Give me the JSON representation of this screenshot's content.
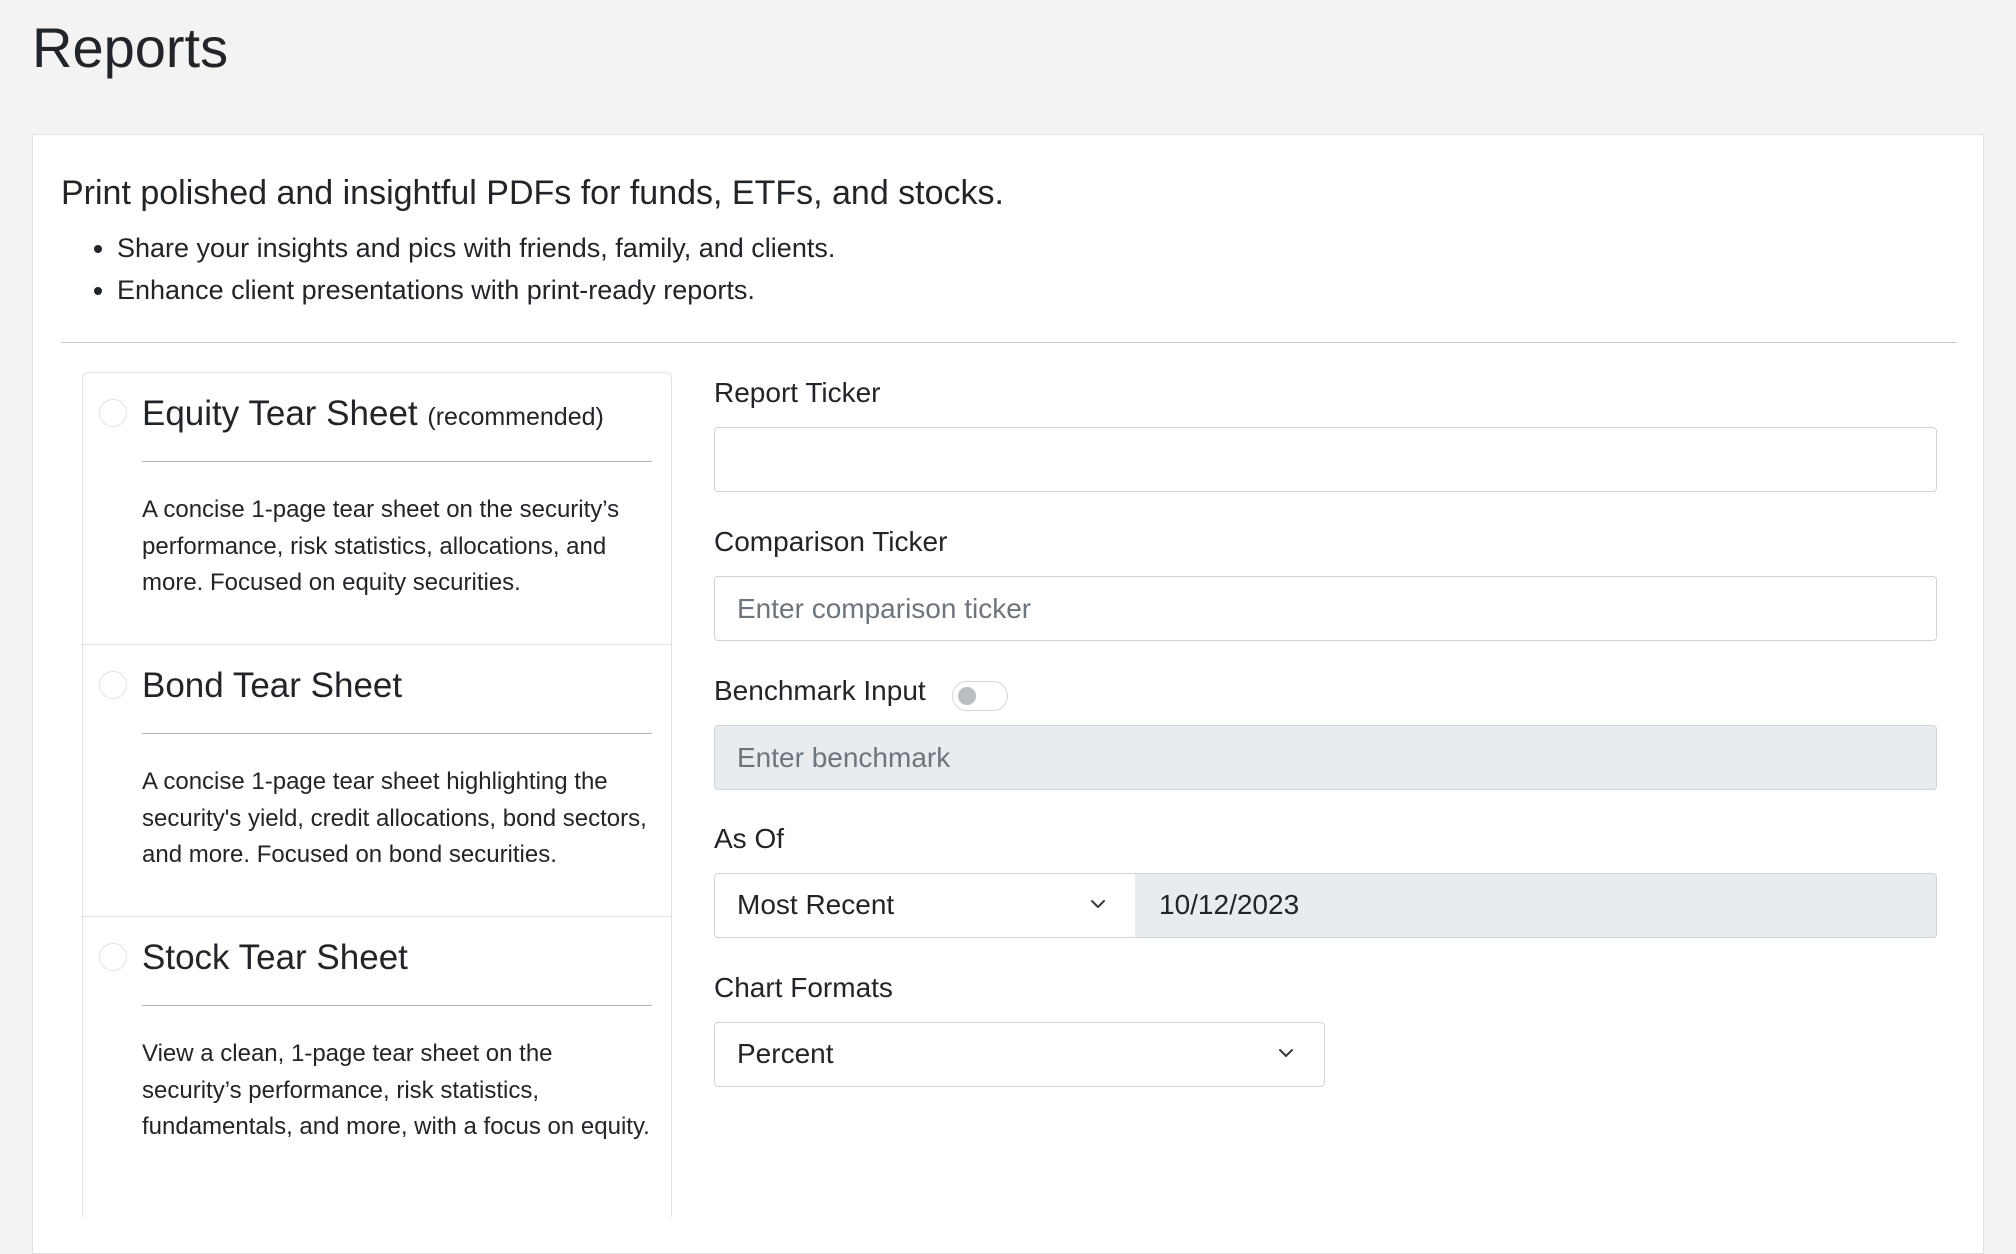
{
  "page": {
    "title": "Reports"
  },
  "intro": {
    "lead": "Print polished and insightful PDFs for funds, ETFs, and stocks.",
    "bullets": [
      "Share your insights and pics with friends, family, and clients.",
      "Enhance client presentations with print-ready reports."
    ]
  },
  "report_types": [
    {
      "title": "Equity Tear Sheet",
      "tag": "(recommended)",
      "description": "A concise 1-page tear sheet on the security’s performance, risk statistics, allocations, and more. Focused on equity securities.",
      "selected": false
    },
    {
      "title": "Bond Tear Sheet",
      "tag": "",
      "description": "A concise 1-page tear sheet highlighting the security's yield, credit allocations, bond sectors, and more. Focused on bond securities.",
      "selected": false
    },
    {
      "title": "Stock Tear Sheet",
      "tag": "",
      "description": "View a clean, 1-page tear sheet on the security’s performance, risk statistics, fundamentals, and more, with a focus on equity.",
      "selected": false
    }
  ],
  "form": {
    "report_ticker": {
      "label": "Report Ticker",
      "value": "",
      "placeholder": ""
    },
    "comparison_ticker": {
      "label": "Comparison Ticker",
      "value": "",
      "placeholder": "Enter comparison ticker"
    },
    "benchmark": {
      "label": "Benchmark Input",
      "toggle_on": false,
      "value": "",
      "placeholder": "Enter benchmark"
    },
    "as_of": {
      "label": "As Of",
      "selected": "Most Recent",
      "date": "10/12/2023"
    },
    "chart_formats": {
      "label": "Chart Formats",
      "selected": "Percent"
    }
  },
  "icons": {
    "dropdown": "chevron-down-icon",
    "radio": "radio-unchecked-icon"
  },
  "colors": {
    "background": "#f3f3f4",
    "card": "#ffffff",
    "border": "#dee2e6",
    "disabled_field": "#e9ecef",
    "text": "#212529",
    "placeholder": "#6c757d"
  }
}
